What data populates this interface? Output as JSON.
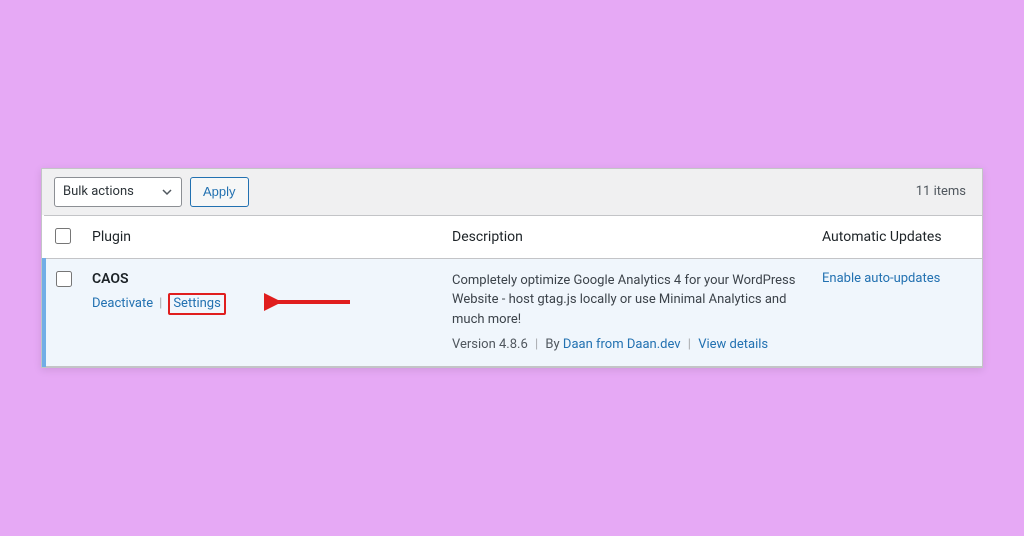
{
  "toolbar": {
    "bulk_label": "Bulk actions",
    "apply_label": "Apply",
    "count_text": "11 items"
  },
  "columns": {
    "plugin": "Plugin",
    "description": "Description",
    "auto_updates": "Automatic Updates"
  },
  "plugin": {
    "name": "CAOS",
    "deactivate": "Deactivate",
    "settings": "Settings",
    "description": "Completely optimize Google Analytics 4 for your WordPress Website - host gtag.js locally or use Minimal Analytics and much more!",
    "version_prefix": "Version 4.8.6",
    "by_text": "By",
    "author": "Daan from Daan.dev",
    "view_details": "View details",
    "enable_auto": "Enable auto-updates"
  }
}
